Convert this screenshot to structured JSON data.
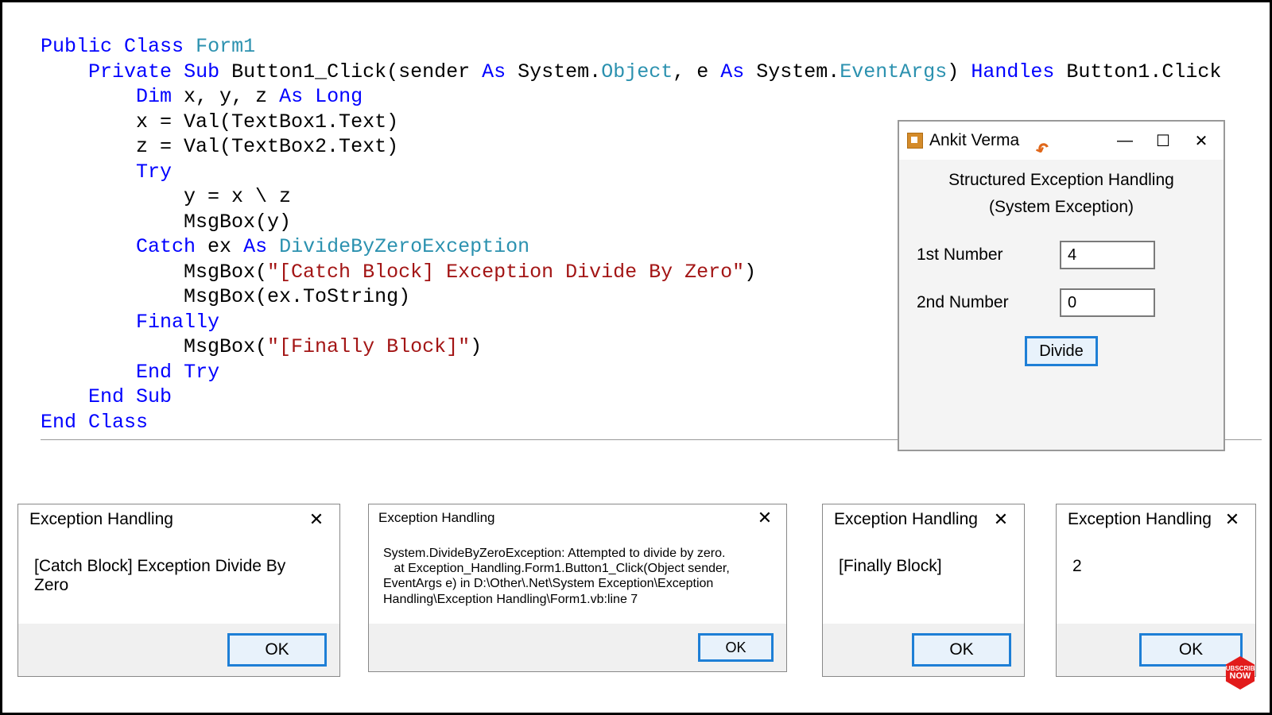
{
  "code_tokens": {
    "l1": [
      "Public",
      " ",
      "Class",
      " ",
      "Form1"
    ],
    "l2": [
      "    ",
      "Private",
      " ",
      "Sub",
      " Button1_Click(sender ",
      "As",
      " System.",
      "Object",
      ", e ",
      "As",
      " System.",
      "EventArgs",
      ") ",
      "Handles",
      " Button1.Click"
    ],
    "l3": [
      "        ",
      "Dim",
      " x, y, z ",
      "As",
      " ",
      "Long"
    ],
    "l4": "        x = Val(TextBox1.Text)",
    "l5": "        z = Val(TextBox2.Text)",
    "l6": [
      "        ",
      "Try"
    ],
    "l7": "            y = x \\ z",
    "l8": "            MsgBox(y)",
    "l9": [
      "        ",
      "Catch",
      " ex ",
      "As",
      " ",
      "DivideByZeroException"
    ],
    "l10a": "            MsgBox(",
    "l10s": "\"[Catch Block] Exception Divide By Zero\"",
    "l10b": ")",
    "l11": "            MsgBox(ex.ToString)",
    "l12": [
      "        ",
      "Finally"
    ],
    "l13a": "            MsgBox(",
    "l13s": "\"[Finally Block]\"",
    "l13b": ")",
    "l14": [
      "        ",
      "End",
      " ",
      "Try"
    ],
    "l15": [
      "    ",
      "End",
      " ",
      "Sub"
    ],
    "l16": [
      "End",
      " ",
      "Class"
    ]
  },
  "form": {
    "window_title": "Ankit Verma",
    "heading1": "Structured Exception Handling",
    "heading2": "(System Exception)",
    "label1": "1st Number",
    "label2": "2nd Number",
    "value1": "4",
    "value2": "0",
    "button": "Divide"
  },
  "msgboxes": {
    "title": "Exception Handling",
    "ok": "OK",
    "m1": "[Catch Block] Exception Divide By Zero",
    "m2": "System.DivideByZeroException: Attempted to divide by zero.\n   at Exception_Handling.Form1.Button1_Click(Object sender, EventArgs e) in D:\\Other\\.Net\\System Exception\\Exception Handling\\Exception Handling\\Form1.vb:line 7",
    "m3": "[Finally Block]",
    "m4": "2"
  },
  "badge": {
    "line1": "SUBSCRIBE",
    "line2": "NOW"
  },
  "glyphs": {
    "min": "—",
    "max": "☐",
    "close": "✕"
  }
}
